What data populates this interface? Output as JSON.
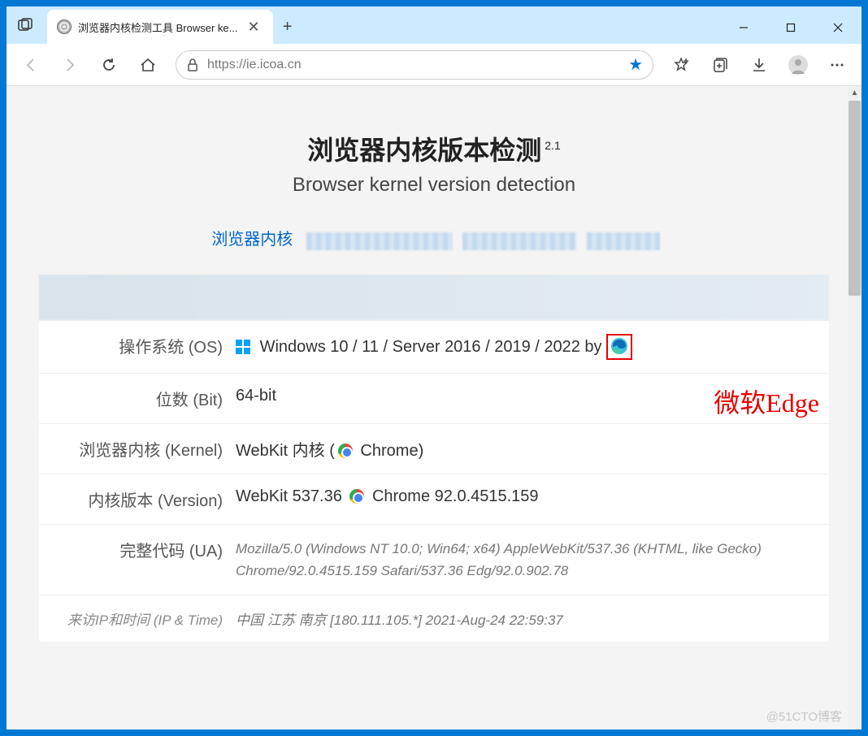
{
  "window": {
    "tab_title": "浏览器内核检测工具 Browser ke...",
    "new_tab_icon": "plus-icon",
    "controls": {
      "min": "—",
      "max": "☐",
      "close": "✕"
    }
  },
  "toolbar": {
    "url": "https://ie.icoa.cn"
  },
  "page": {
    "title": "浏览器内核版本检测",
    "version_sup": "2.1",
    "subtitle": "Browser kernel version detection",
    "nav_link_kernel": "浏览器内核",
    "annotation": "微软Edge"
  },
  "rows": {
    "os_label": "操作系统 (OS)",
    "os_value": "Windows 10 / 11 / Server 2016 / 2019 / 2022 by ",
    "bit_label": "位数 (Bit)",
    "bit_value": "64-bit",
    "kernel_label": "浏览器内核 (Kernel)",
    "kernel_value_a": "WebKit 内核 (",
    "kernel_value_b": " Chrome)",
    "version_label": "内核版本 (Version)",
    "version_value_a": "WebKit 537.36 ",
    "version_value_b": " Chrome 92.0.4515.159",
    "ua_label": "完整代码 (UA)",
    "ua_value": "Mozilla/5.0 (Windows NT 10.0; Win64; x64) AppleWebKit/537.36 (KHTML, like Gecko) Chrome/92.0.4515.159 Safari/537.36 Edg/92.0.902.78",
    "iptime_label": "来访IP和时间 (IP & Time)",
    "iptime_value": "中国 江苏 南京 [180.111.105.*]   2021-Aug-24 22:59:37"
  },
  "watermark": "@51CTO博客"
}
